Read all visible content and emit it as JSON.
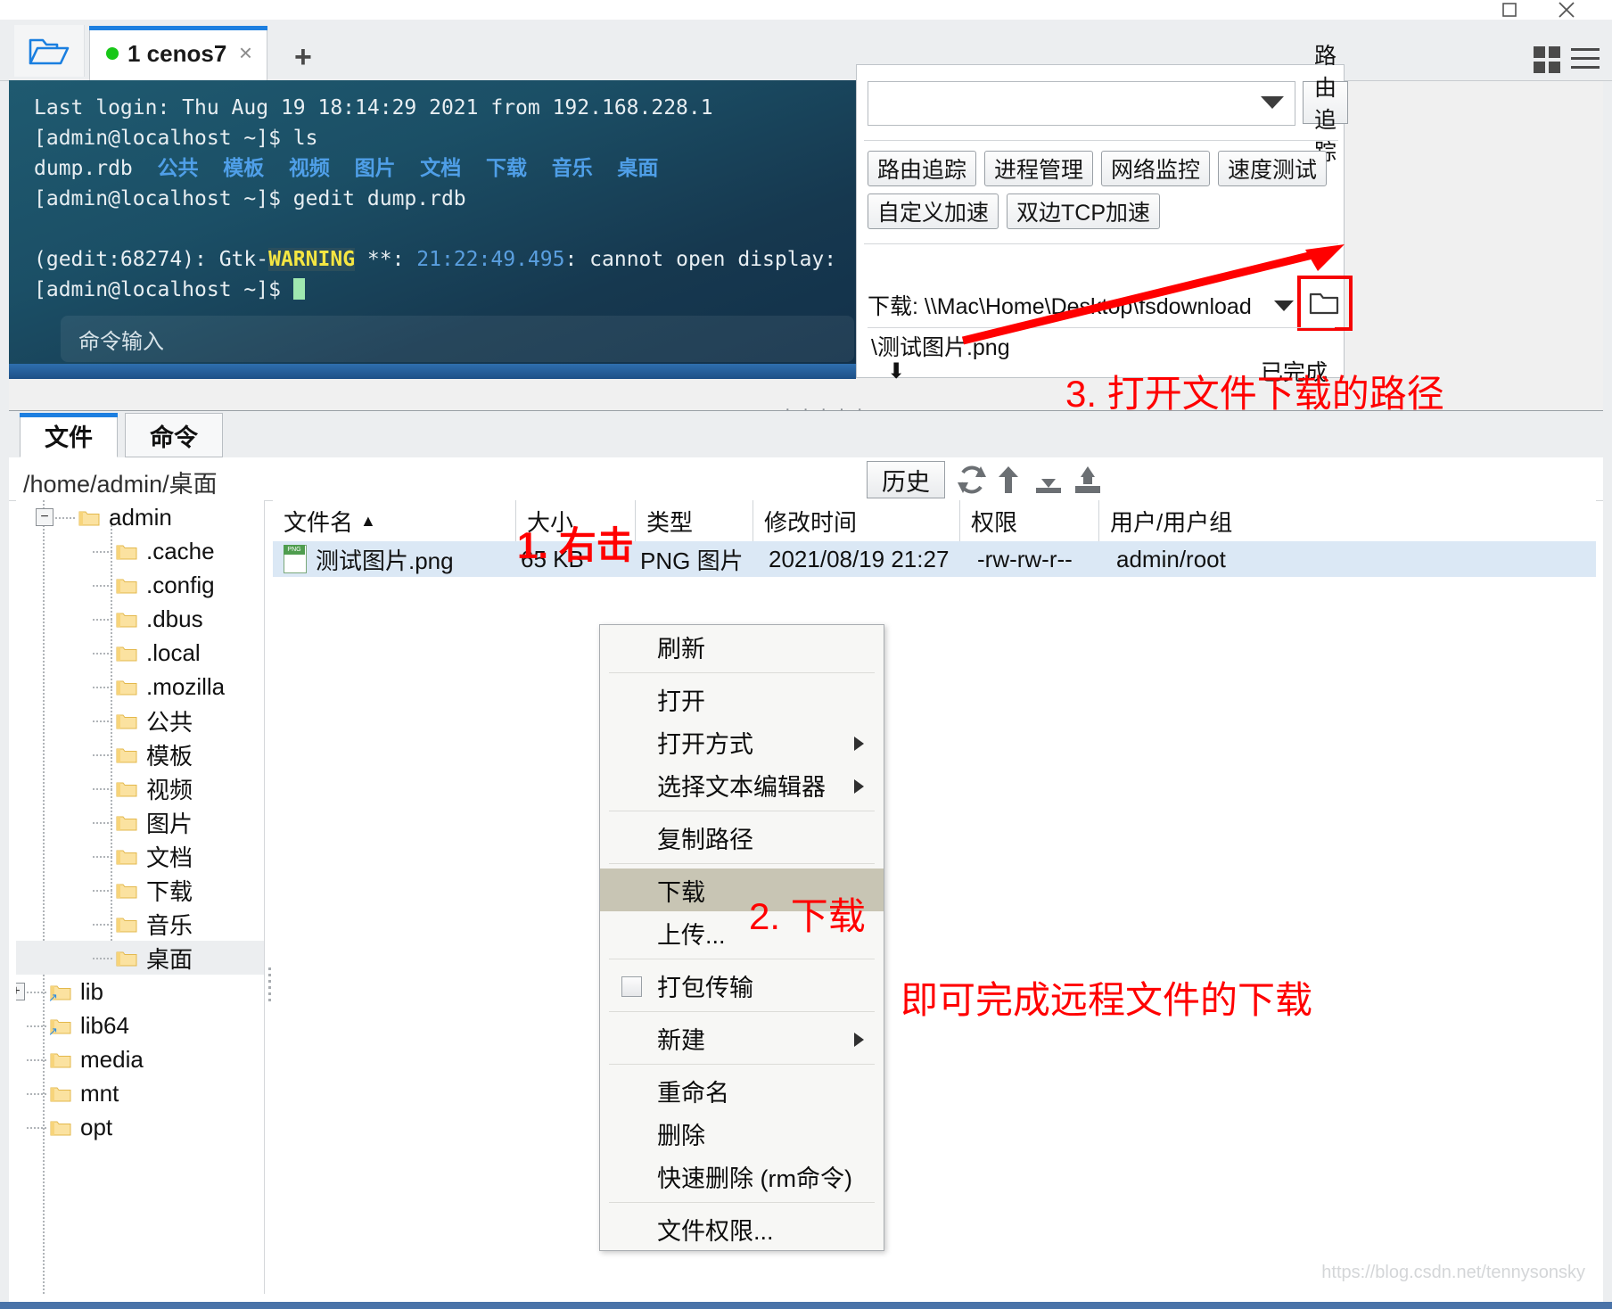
{
  "window": {
    "minimize": "▢",
    "close": "✕"
  },
  "tabbar": {
    "folder_icon": "open-folder-icon",
    "tab_label": "1 cenos7",
    "tab_close": "×",
    "new_tab": "+",
    "grid_icon": "grid-view-icon",
    "menu_icon": "hamburger-menu-icon"
  },
  "terminal": {
    "line1": "Last login: Thu Aug 19 18:14:29 2021 from 192.168.228.1",
    "line2_prompt": "[admin@localhost ~]$ ",
    "line2_cmd": "ls",
    "ls_file": "dump.rdb",
    "ls_dirs": [
      "公共",
      "模板",
      "视频",
      "图片",
      "文档",
      "下载",
      "音乐",
      "桌面"
    ],
    "line4_prompt": "[admin@localhost ~]$ ",
    "line4_cmd": "gedit dump.rdb",
    "warn_pre": "(gedit:68274): Gtk-",
    "warn_word": "WARNING",
    "warn_mid": " **: ",
    "warn_time": "21:22:49.495",
    "warn_post": ": cannot open display:",
    "line6_prompt": "[admin@localhost ~]$ ",
    "command_input_placeholder": "命令输入"
  },
  "toolpanel": {
    "combo_value": "",
    "trace_button": "路由追踪",
    "buttons_row1": [
      "路由追踪",
      "进程管理",
      "网络监控",
      "速度测试"
    ],
    "buttons_row2": [
      "自定义加速",
      "双边TCP加速"
    ],
    "download_path_label": "下载: \\\\Mac\\Home\\Desktop\\fsdownload",
    "open_folder_icon": "folder-icon",
    "download_item_name": "\\测试图片.png",
    "download_item_icon": "download-arrow-icon",
    "download_item_status": "已完成"
  },
  "annotations": {
    "step1": "1. 右击",
    "step2": "2. 下载",
    "step3": "3. 打开文件下载的路径",
    "result": "即可完成远程文件的下载",
    "color": "#ff0000"
  },
  "filemanager": {
    "tabs": [
      {
        "label": "文件",
        "active": true
      },
      {
        "label": "命令",
        "active": false
      }
    ],
    "path": "/home/admin/桌面",
    "history_button": "历史",
    "toolbar_icons": [
      "refresh-icon",
      "upload-arrow-icon",
      "download-to-disk-icon",
      "upload-from-disk-icon"
    ],
    "tree": [
      {
        "label": "admin",
        "depth": 1,
        "expander": "−",
        "selected": false
      },
      {
        "label": ".cache",
        "depth": 2,
        "expander": "",
        "selected": false
      },
      {
        "label": ".config",
        "depth": 2,
        "expander": "",
        "selected": false
      },
      {
        "label": ".dbus",
        "depth": 2,
        "expander": "",
        "selected": false
      },
      {
        "label": ".local",
        "depth": 2,
        "expander": "",
        "selected": false
      },
      {
        "label": ".mozilla",
        "depth": 2,
        "expander": "",
        "selected": false
      },
      {
        "label": "公共",
        "depth": 2,
        "expander": "",
        "selected": false
      },
      {
        "label": "模板",
        "depth": 2,
        "expander": "",
        "selected": false
      },
      {
        "label": "视频",
        "depth": 2,
        "expander": "",
        "selected": false
      },
      {
        "label": "图片",
        "depth": 2,
        "expander": "",
        "selected": false
      },
      {
        "label": "文档",
        "depth": 2,
        "expander": "",
        "selected": false
      },
      {
        "label": "下载",
        "depth": 2,
        "expander": "",
        "selected": false
      },
      {
        "label": "音乐",
        "depth": 2,
        "expander": "",
        "selected": false
      },
      {
        "label": "桌面",
        "depth": 2,
        "expander": "",
        "selected": true
      },
      {
        "label": "lib",
        "depth": 0,
        "expander": "+",
        "selected": false,
        "link": true
      },
      {
        "label": "lib64",
        "depth": 0,
        "expander": "",
        "selected": false,
        "link": true
      },
      {
        "label": "media",
        "depth": 0,
        "expander": "",
        "selected": false
      },
      {
        "label": "mnt",
        "depth": 0,
        "expander": "",
        "selected": false
      },
      {
        "label": "opt",
        "depth": 0,
        "expander": "",
        "selected": false
      }
    ],
    "columns": [
      {
        "label": "文件名",
        "sort": "▲"
      },
      {
        "label": "大小",
        "sort": ""
      },
      {
        "label": "类型",
        "sort": ""
      },
      {
        "label": "修改时间",
        "sort": ""
      },
      {
        "label": "权限",
        "sort": ""
      },
      {
        "label": "用户/用户组",
        "sort": ""
      }
    ],
    "rows": [
      {
        "name": "测试图片.png",
        "size": "65 KB",
        "type": "PNG 图片",
        "mtime": "2021/08/19 21:27",
        "perm": "-rw-rw-r--",
        "owner": "admin/root"
      }
    ]
  },
  "contextmenu": {
    "items": [
      {
        "label": "刷新",
        "submenu": false,
        "checkbox": false,
        "highlight": false,
        "sep_after": true
      },
      {
        "label": "打开",
        "submenu": false,
        "checkbox": false,
        "highlight": false,
        "sep_after": false
      },
      {
        "label": "打开方式",
        "submenu": true,
        "checkbox": false,
        "highlight": false,
        "sep_after": false
      },
      {
        "label": "选择文本编辑器",
        "submenu": true,
        "checkbox": false,
        "highlight": false,
        "sep_after": true
      },
      {
        "label": "复制路径",
        "submenu": false,
        "checkbox": false,
        "highlight": false,
        "sep_after": true
      },
      {
        "label": "下载",
        "submenu": false,
        "checkbox": false,
        "highlight": true,
        "sep_after": false
      },
      {
        "label": "上传...",
        "submenu": false,
        "checkbox": false,
        "highlight": false,
        "sep_after": true
      },
      {
        "label": "打包传输",
        "submenu": false,
        "checkbox": true,
        "highlight": false,
        "sep_after": true
      },
      {
        "label": "新建",
        "submenu": true,
        "checkbox": false,
        "highlight": false,
        "sep_after": true
      },
      {
        "label": "重命名",
        "submenu": false,
        "checkbox": false,
        "highlight": false,
        "sep_after": false
      },
      {
        "label": "删除",
        "submenu": false,
        "checkbox": false,
        "highlight": false,
        "sep_after": false
      },
      {
        "label": "快速删除 (rm命令)",
        "submenu": false,
        "checkbox": false,
        "highlight": false,
        "sep_after": true
      },
      {
        "label": "文件权限...",
        "submenu": false,
        "checkbox": false,
        "highlight": false,
        "sep_after": false
      }
    ]
  },
  "watermark": "https://blog.csdn.net/tennysonsky"
}
